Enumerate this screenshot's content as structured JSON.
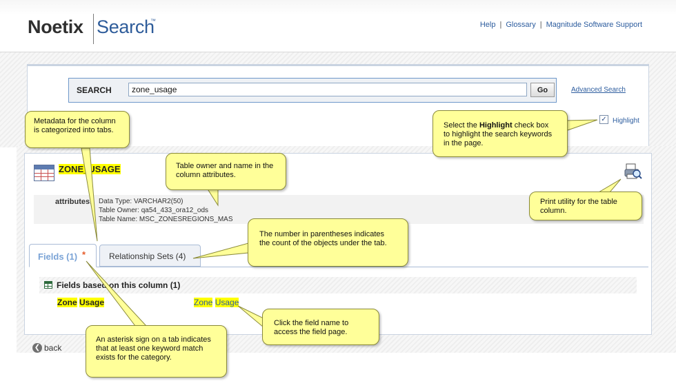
{
  "header": {
    "logo_noetix": "Noetix",
    "logo_search": "Search",
    "logo_tm": "™",
    "links": [
      "Help",
      "Glossary",
      "Magnitude Software Support"
    ],
    "separator": "|"
  },
  "search": {
    "label": "SEARCH",
    "query": "zone_usage",
    "go_label": "Go",
    "advanced_label": "Advanced Search",
    "highlight_checked": "✓",
    "highlight_label": "Highlight"
  },
  "page": {
    "title": "ZONE_USAGE",
    "attributes_label": "attributes:",
    "attributes": [
      "Data Type: VARCHAR2(50)",
      "Table Owner: qa54_433_ora12_ods",
      "Table Name: MSC_ZONESREGIONS_MAS"
    ]
  },
  "tabs": [
    {
      "label": "Fields (1)",
      "marker": "*",
      "active": true
    },
    {
      "label": "Relationship Sets (4)",
      "active": false
    }
  ],
  "fields": {
    "header": "Fields based on this column  (1)",
    "rows": [
      {
        "name_part1": "Zone",
        "name_part2": "Usage",
        "link_part1": "Zone",
        "link_part2": "Usage"
      }
    ]
  },
  "back_label": "back",
  "callouts": {
    "tabs_metadata": "Metadata for the column is categorized into tabs.",
    "highlight_intro": "Select the ",
    "highlight_bold": "Highlight",
    "highlight_rest": " check box to highlight the search keywords in the page.",
    "owner_name": "Table owner and name in the column attributes.",
    "print": "Print utility for the table column.",
    "count": "The number in parentheses indicates the count of the objects under the tab.",
    "field_link": "Click the field name to access the field page.",
    "asterisk": "An asterisk sign on a tab indicates that at least one keyword match exists for the category."
  },
  "colors": {
    "brand_blue": "#2e5c9a",
    "highlight": "#ffff00",
    "callout_bg": "#ffff99",
    "asterisk": "#e65c2a"
  }
}
